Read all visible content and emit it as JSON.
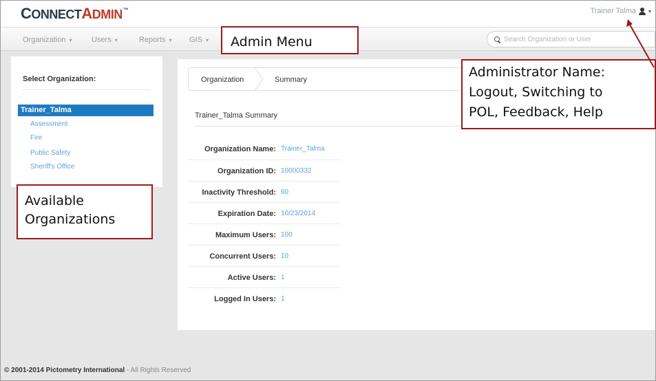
{
  "header": {
    "logo_first": "C",
    "logo_mid": "ONNECT",
    "logo_second": "A",
    "logo_end": "DMIN",
    "logo_tm": "™",
    "user_name": "Trainer Talma"
  },
  "nav": {
    "items": [
      {
        "label": "Organization"
      },
      {
        "label": "Users"
      },
      {
        "label": "Reports"
      },
      {
        "label": "GIS"
      }
    ],
    "search_placeholder": "Search Organization or User"
  },
  "sidebar": {
    "heading": "Select Organization:",
    "selected": "Trainer_Talma",
    "orgs": [
      "Assessment",
      "Fire",
      "Public Safety",
      "Sheriff's Office"
    ]
  },
  "breadcrumb": {
    "first": "Organization",
    "second": "Summary"
  },
  "summary": {
    "title": "Trainer_Talma Summary",
    "rows": [
      {
        "label": "Organization Name:",
        "value": "Trainer_Talma"
      },
      {
        "label": "Organization ID:",
        "value": "10000332"
      },
      {
        "label": "Inactivity Threshold:",
        "value": "60"
      },
      {
        "label": "Expiration Date:",
        "value": "10/23/2014"
      },
      {
        "label": "Maximum Users:",
        "value": "100"
      },
      {
        "label": "Concurrent Users:",
        "value": "10"
      },
      {
        "label": "Active Users:",
        "value": "1"
      },
      {
        "label": "Logged In Users:",
        "value": "1"
      }
    ]
  },
  "footer": {
    "copyright": "© 2001-2014 Pictometry International",
    "rest": " - All Rights Reserved"
  },
  "callouts": {
    "menu": "Admin Menu",
    "admin_line1": "Administrator Name:",
    "admin_line2": "Logout, Switching to",
    "admin_line3": "POL, Feedback, Help",
    "orgs_line1": "Available",
    "orgs_line2": "Organizations"
  },
  "colors": {
    "accent": "#1f7bc1",
    "link": "#5fa3d6",
    "logo_red": "#c0392b",
    "callout_border": "#9b1b1b"
  }
}
